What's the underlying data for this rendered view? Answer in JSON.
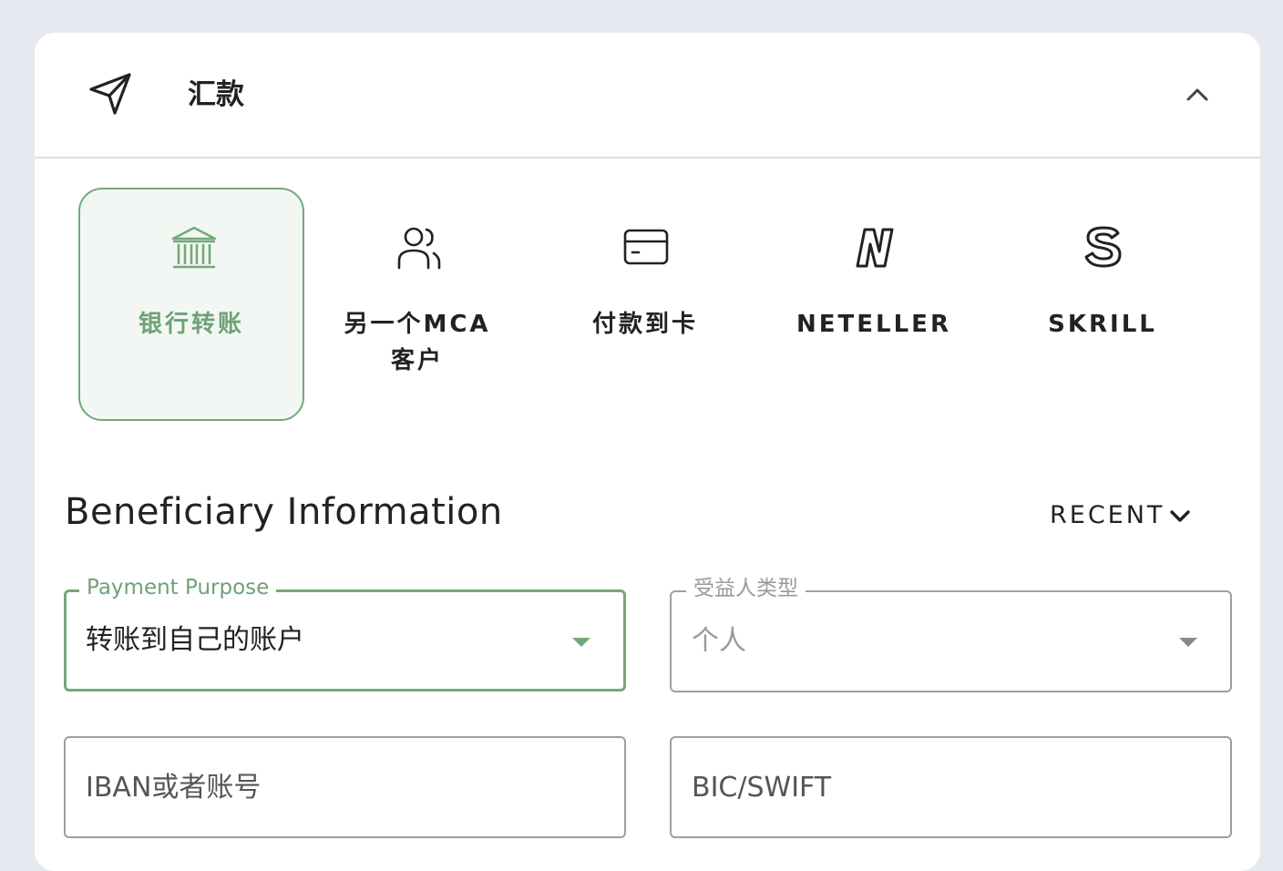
{
  "header": {
    "title": "汇款",
    "icon": "send-icon",
    "collapse_icon": "chevron-up-icon"
  },
  "methods": [
    {
      "label": "银行转账",
      "label2": "",
      "icon": "bank-icon",
      "active": true
    },
    {
      "label": "另一个MCA",
      "label2": "客户",
      "icon": "users-icon",
      "active": false
    },
    {
      "label": "付款到卡",
      "label2": "",
      "icon": "card-icon",
      "active": false
    },
    {
      "label": "NETELLER",
      "label2": "",
      "icon": "neteller-logo-icon",
      "active": false
    },
    {
      "label": "SKRILL",
      "label2": "",
      "icon": "skrill-logo-icon",
      "active": false
    }
  ],
  "beneficiary": {
    "title": "Beneficiary Information",
    "recent_label": "RECENT"
  },
  "fields": {
    "payment_purpose": {
      "label": "Payment Purpose",
      "value": "转账到自己的账户"
    },
    "beneficiary_type": {
      "label": "受益人类型",
      "value": "个人"
    },
    "iban": {
      "placeholder": "IBAN或者账号"
    },
    "bic": {
      "placeholder": "BIC/SWIFT"
    }
  },
  "colors": {
    "accent": "#74a87b",
    "background": "#e6e9f0",
    "text": "#222222"
  }
}
